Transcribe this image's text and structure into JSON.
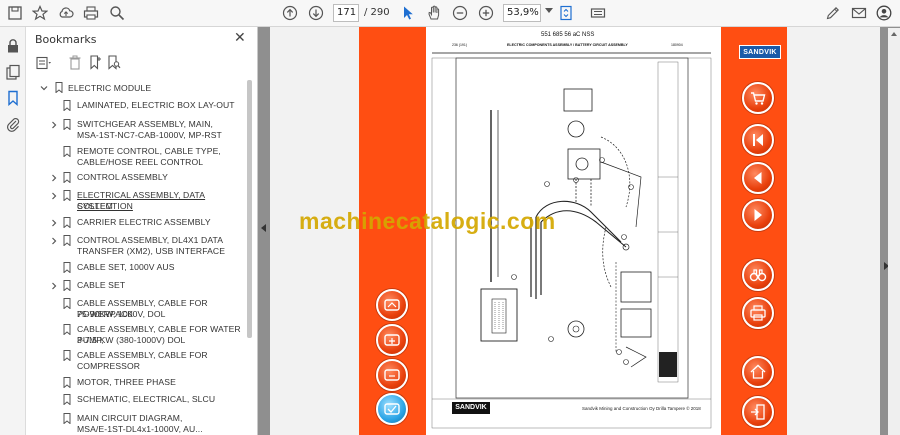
{
  "toolbar": {
    "page_current": "171",
    "page_total": "/  290",
    "zoom": "53,9%"
  },
  "panel": {
    "title": "Bookmarks",
    "items": [
      {
        "label": "ELECTRIC MODULE"
      },
      {
        "label": "LAMINATED, ELECTRIC BOX LAY-OUT"
      },
      {
        "label": "SWITCHGEAR ASSEMBLY, MAIN,"
      },
      {
        "label": "MSA-1ST-NC7-CAB-1000V, MP-RST"
      },
      {
        "label": "REMOTE CONTROL, CABLE TYPE,"
      },
      {
        "label": "CABLE/HOSE REEL CONTROL"
      },
      {
        "label": "CONTROL ASSEMBLY"
      },
      {
        "label": "ELECTRICAL ASSEMBLY, DATA COLLECTION"
      },
      {
        "label": "SYSTEM"
      },
      {
        "label": "CARRIER ELECTRIC ASSEMBLY"
      },
      {
        "label": "CONTROL ASSEMBLY, DL4X1 DATA"
      },
      {
        "label": "TRANSFER (XM2), USB INTERFACE"
      },
      {
        "label": "CABLE SET, 1000V AUS"
      },
      {
        "label": "CABLE SET"
      },
      {
        "label": "CABLE ASSEMBLY, CABLE FOR POWERPACK"
      },
      {
        "label": "75-90KW, 1000V, DOL"
      },
      {
        "label": "CABLE ASSEMBLY, CABLE FOR WATER PUMP,"
      },
      {
        "label": "3-7.5 KW (380-1000V) DOL"
      },
      {
        "label": "CABLE ASSEMBLY, CABLE FOR"
      },
      {
        "label": "COMPRESSOR"
      },
      {
        "label": "MOTOR, THREE PHASE"
      },
      {
        "label": "SCHEMATIC, ELECTRICAL, SLCU"
      },
      {
        "label": "MAIN CIRCUIT DIAGRAM,"
      },
      {
        "label": "MSA/E-1ST-DL4x1-1000V, AU..."
      }
    ]
  },
  "sheet": {
    "part_number": "551 685 56 aC NSS",
    "header_left": "236 (191)",
    "header_title": "ELECTRIC COMPONENTS ASSEMBLY / BATTERY CIRCUIT ASSEMBLY",
    "header_right": "180904",
    "brand": "SANDVIK",
    "footer_caption": "Sandvik Mining and Construction Oy Drilla Tampere © 2018"
  },
  "watermark": "machinecatalogic.com"
}
